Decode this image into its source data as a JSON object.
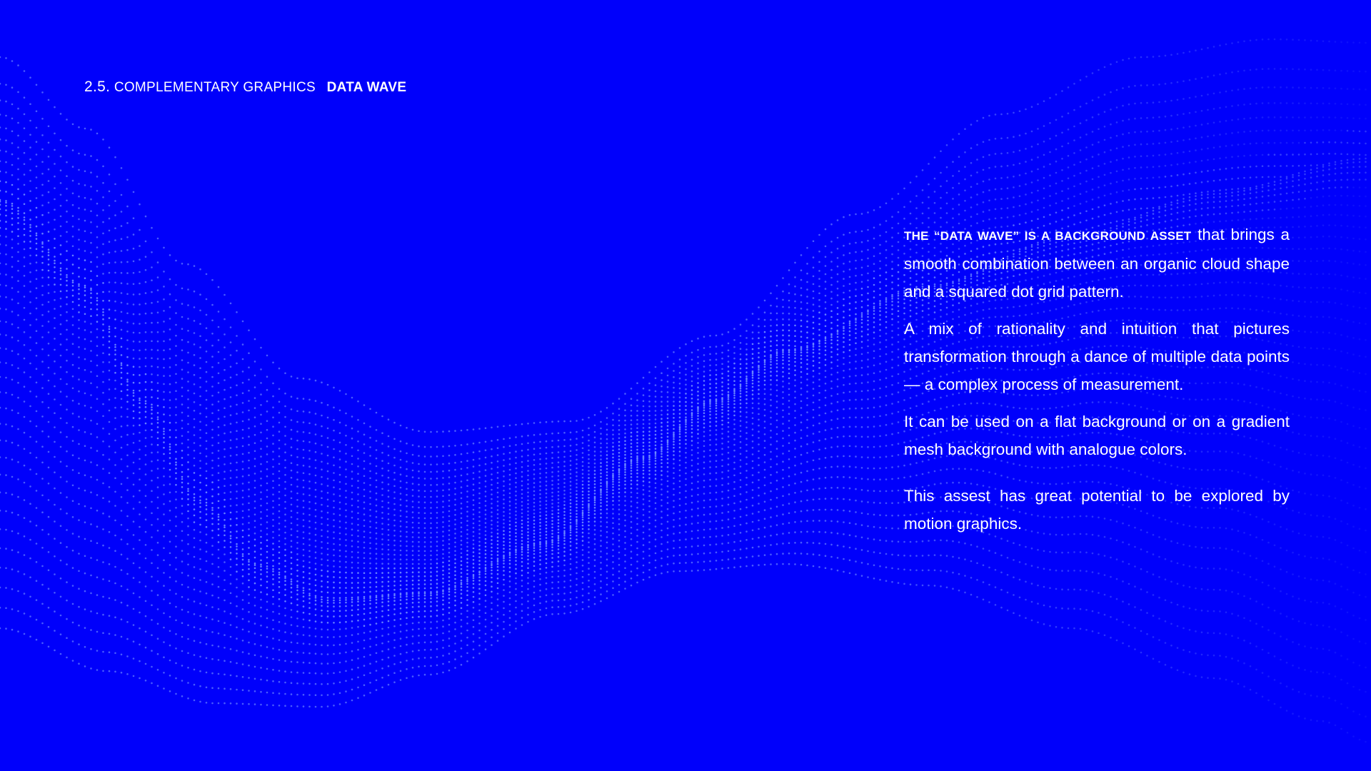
{
  "colors": {
    "background": "#0000fb",
    "text": "#ffffff",
    "dots": "#6f8cff"
  },
  "header": {
    "section_number": "2.5.",
    "section_title": "COMPLEMENTARY GRAPHICS",
    "page_title": "DATA WAVE"
  },
  "body": {
    "lead_caps": "THE “DATA WAVE” IS A BACKGROUND ASSET",
    "paragraph1_rest": "that brings a smooth combination between an organic cloud shape and a squared dot grid pattern.",
    "paragraph2": "A mix of rationality and intuition that pictures transformation through a dance of multiple data points — a complex process of measurement.",
    "paragraph3": "It can be used on a flat background or on a gradient mesh background with analogue colors.",
    "paragraph4": "This assest has great potential to be explored by motion graphics."
  },
  "graphic": {
    "name": "data-wave",
    "icon": "dotted-wave-graphic"
  }
}
